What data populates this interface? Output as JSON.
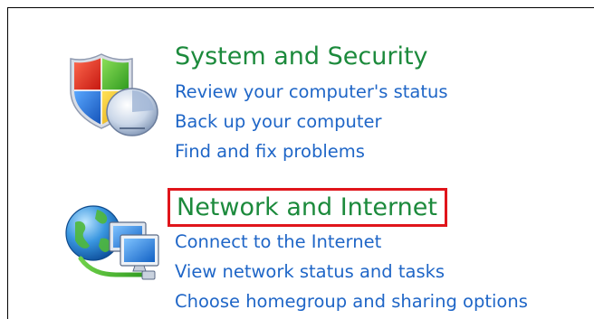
{
  "categories": [
    {
      "title": "System and Security",
      "icon": "shield-monitor-icon",
      "links": [
        "Review your computer's status",
        "Back up your computer",
        "Find and fix problems"
      ]
    },
    {
      "title": "Network and Internet",
      "icon": "network-globe-icon",
      "highlighted": true,
      "links": [
        "Connect to the Internet",
        "View network status and tasks",
        "Choose homegroup and sharing options"
      ]
    }
  ],
  "colors": {
    "title": "#1c8a3c",
    "link": "#1f66c7",
    "highlight_box": "#e0151b",
    "frame_border": "#000000"
  }
}
